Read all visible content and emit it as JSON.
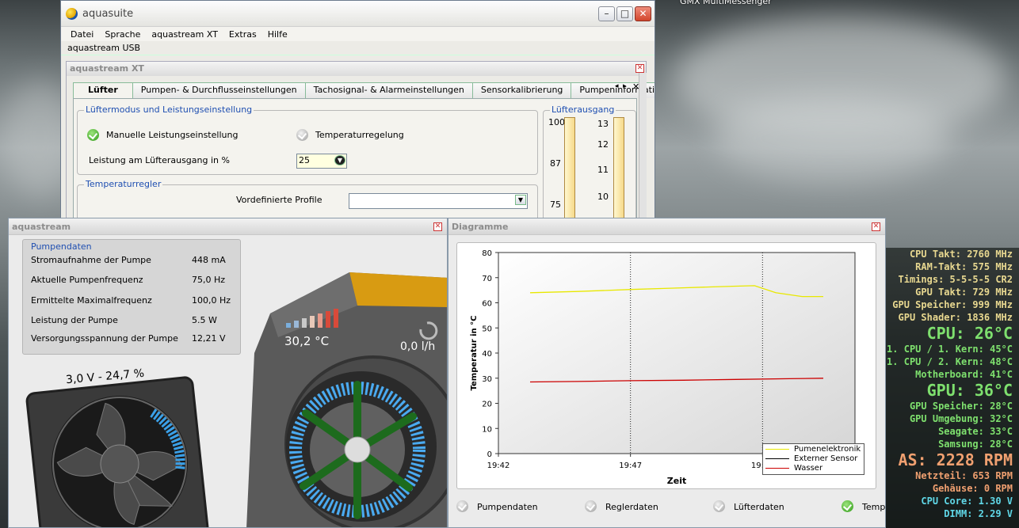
{
  "desktop": {
    "gmx_label": "GMX MultiMessenger"
  },
  "main_window": {
    "title": "aquasuite",
    "menu": [
      "Datei",
      "Sprache",
      "aquastream XT",
      "Extras",
      "Hilfe"
    ],
    "device": "aquastream USB",
    "inner_title": "aquastream XT",
    "tabs": [
      "Lüfter",
      "Pumpen- & Durchflusseinstellungen",
      "Tachosignal- & Alarmeinstellungen",
      "Sensorkalibrierung",
      "Pumpeninformationen &"
    ],
    "fan_group": {
      "label": "Lüftermodus und Leistungseinstellung",
      "manual": "Manuelle Leistungseinstellung",
      "temp_control": "Temperaturregelung",
      "power_label": "Leistung am Lüfterausgang in %",
      "power_value": "25"
    },
    "temp_group": {
      "label": "Temperaturregler",
      "profile_label": "Vordefinierte Profile",
      "profile_value": ""
    },
    "output_group": {
      "label": "Lüfterausgang",
      "ticks_a": [
        "100",
        "87",
        "75"
      ],
      "ticks_b": [
        "13",
        "12",
        "11",
        "10"
      ]
    }
  },
  "aquastream_window": {
    "title": "aquastream",
    "pump_group": "Pumpendaten",
    "rows": [
      {
        "label": "Stromaufnahme der Pumpe",
        "value": "448 mA"
      },
      {
        "label": "Aktuelle Pumpenfrequenz",
        "value": "75,0 Hz"
      },
      {
        "label": "Ermittelte Maximalfrequenz",
        "value": "100,0 Hz"
      },
      {
        "label": "Leistung der Pumpe",
        "value": "5.5 W"
      },
      {
        "label": "Versorgungsspannung der Pumpe",
        "value": "12,21 V"
      }
    ],
    "fan_text": "3,0 V - 24,7 %",
    "temp_text": "30,2 °C",
    "flow_text": "0,0 l/h"
  },
  "diagram_window": {
    "title": "Diagramme",
    "checks": [
      "Pumpendaten",
      "Reglerdaten",
      "Lüfterdaten",
      "Temp"
    ]
  },
  "chart_data": {
    "type": "line",
    "ylabel": "Temperatur in °C",
    "xlabel": "Zeit",
    "ylim": [
      0,
      80
    ],
    "yticks": [
      "0",
      "10",
      "20",
      "30",
      "40",
      "50",
      "60",
      "70",
      "80"
    ],
    "xticks": [
      "19:42",
      "19:47",
      "19:52"
    ],
    "xlim_minutes": [
      0,
      13.5
    ],
    "series": [
      {
        "name": "Pumenelektronik",
        "color": "#e8e800",
        "x": [
          1.2,
          3,
          5,
          6.5,
          8,
          9,
          9.7,
          10.5,
          11.5,
          12.3
        ],
        "values": [
          64,
          64.5,
          65.3,
          65.8,
          66.3,
          66.6,
          66.8,
          64,
          62.5,
          62.5
        ]
      },
      {
        "name": "Externer Sensor",
        "color": "#000000",
        "x": [],
        "values": []
      },
      {
        "name": "Wasser",
        "color": "#cc0000",
        "x": [
          1.2,
          3,
          5,
          7,
          9,
          11,
          12.3
        ],
        "values": [
          28.5,
          28.7,
          29,
          29.2,
          29.5,
          29.8,
          30
        ]
      }
    ],
    "grid_vertical_dotted": [
      "19:47",
      "19:52"
    ],
    "legend_position": "bottom-right"
  },
  "stats": [
    {
      "text": "CPU Takt: 2760 MHz",
      "color": "#e8d890",
      "size": 12
    },
    {
      "text": "RAM-Takt: 575 MHz",
      "color": "#e8d890",
      "size": 12
    },
    {
      "text": "Timings: 5-5-5-5 CR2",
      "color": "#e8d890",
      "size": 12
    },
    {
      "text": "GPU Takt: 729 MHz",
      "color": "#e8d890",
      "size": 12
    },
    {
      "text": "GPU Speicher: 999 MHz",
      "color": "#e8d890",
      "size": 12
    },
    {
      "text": "GPU Shader: 1836 MHz",
      "color": "#e8d890",
      "size": 12
    },
    {
      "text": "CPU: 26°C",
      "color": "#7ee06e",
      "size": 20
    },
    {
      "text": "1. CPU / 1. Kern: 45°C",
      "color": "#7ee06e",
      "size": 12
    },
    {
      "text": "1. CPU / 2. Kern: 48°C",
      "color": "#7ee06e",
      "size": 12
    },
    {
      "text": "Motherboard: 41°C",
      "color": "#7ee06e",
      "size": 12
    },
    {
      "text": "GPU: 36°C",
      "color": "#7ee06e",
      "size": 20
    },
    {
      "text": "GPU Speicher: 28°C",
      "color": "#7ee06e",
      "size": 12
    },
    {
      "text": "GPU Umgebung: 32°C",
      "color": "#7ee06e",
      "size": 12
    },
    {
      "text": "Seagate: 33°C",
      "color": "#7ee06e",
      "size": 12
    },
    {
      "text": "Samsung: 28°C",
      "color": "#7ee06e",
      "size": 12
    },
    {
      "text": "AS: 2228 RPM",
      "color": "#f0a070",
      "size": 20
    },
    {
      "text": "Netzteil: 653 RPM",
      "color": "#f0a070",
      "size": 12
    },
    {
      "text": "Gehäuse: 0 RPM",
      "color": "#f0a070",
      "size": 12
    },
    {
      "text": "CPU Core: 1.30 V",
      "color": "#60d8e8",
      "size": 12
    },
    {
      "text": "DIMM: 2.29 V",
      "color": "#60d8e8",
      "size": 12
    }
  ]
}
